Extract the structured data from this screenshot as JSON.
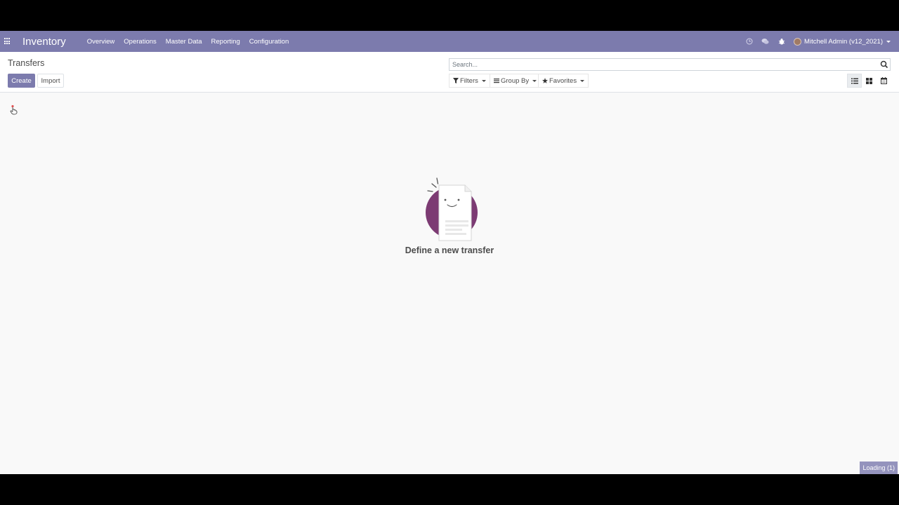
{
  "app": {
    "title": "Inventory",
    "menu": [
      {
        "label": "Overview"
      },
      {
        "label": "Operations"
      },
      {
        "label": "Master Data"
      },
      {
        "label": "Reporting"
      },
      {
        "label": "Configuration"
      }
    ],
    "user": "Mitchell Admin (v12_2021)"
  },
  "control_panel": {
    "breadcrumb": "Transfers",
    "create_label": "Create",
    "import_label": "Import",
    "search_placeholder": "Search...",
    "filters_label": "Filters",
    "groupby_label": "Group By",
    "favorites_label": "Favorites",
    "active_view": "list"
  },
  "empty_state": {
    "title": "Define a new transfer"
  },
  "status": {
    "loading": "Loading (1)"
  },
  "colors": {
    "brand": "#7c7bad",
    "empty_circle": "#7c3b73"
  }
}
